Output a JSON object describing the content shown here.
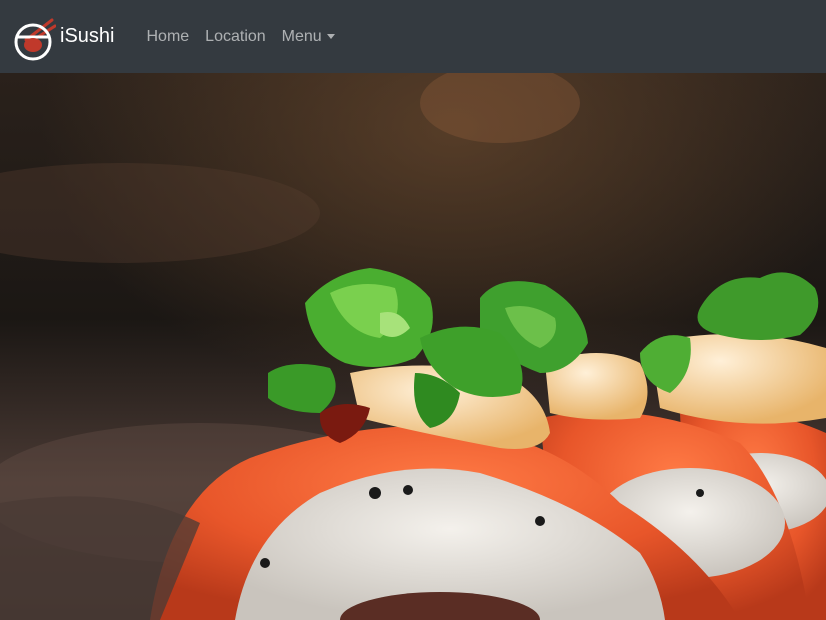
{
  "brand": {
    "name": "iSushi",
    "logo_icon": "sushi-bowl-chopsticks-icon",
    "accent_color": "#c0392b"
  },
  "nav": {
    "items": [
      {
        "label": "Home"
      },
      {
        "label": "Location"
      },
      {
        "label": "Menu",
        "dropdown": true,
        "icon": "caret-down-icon"
      }
    ]
  },
  "hero": {
    "subject": "salmon sushi rolls topped with green onion",
    "icon": "hero-image"
  },
  "colors": {
    "navbar_bg": "#343a40",
    "nav_text": "rgba(255,255,255,0.6)",
    "brand_text": "#ffffff"
  }
}
